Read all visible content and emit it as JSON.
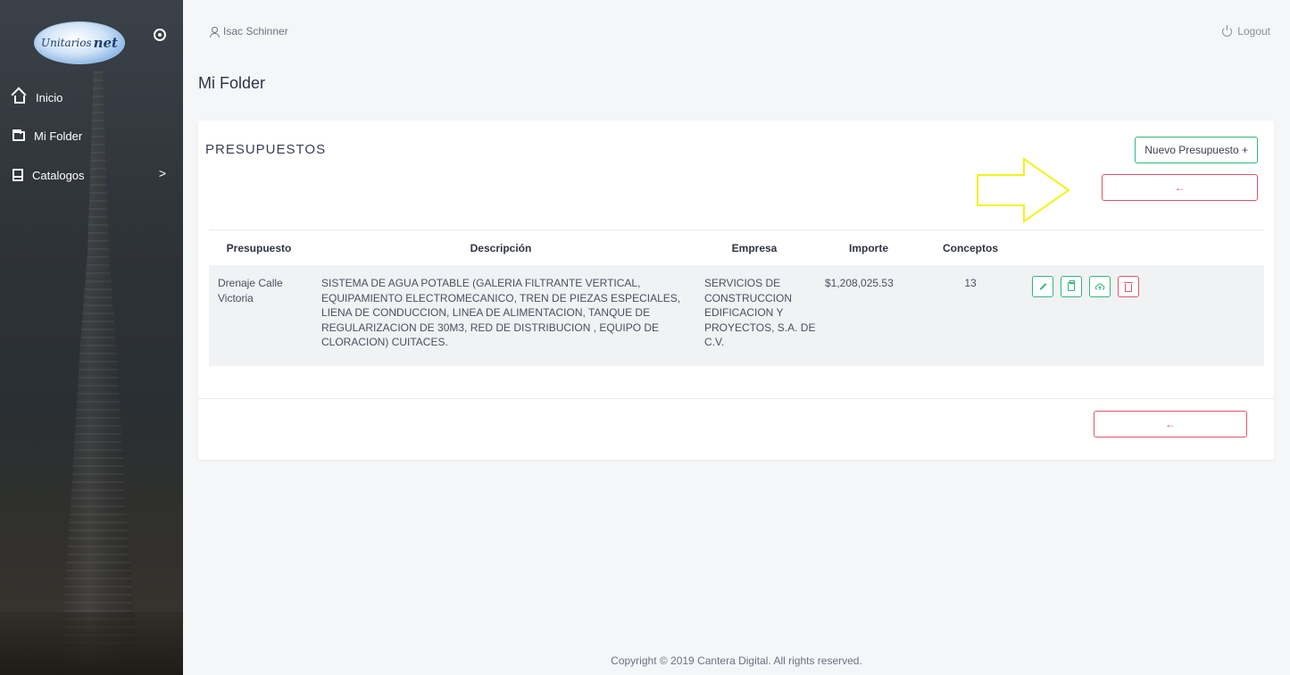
{
  "sidebar": {
    "logo_text": "Unitarios",
    "logo_suffix": "net",
    "items": [
      {
        "label": "Inicio",
        "icon": "home-icon"
      },
      {
        "label": "Mi Folder",
        "icon": "folder-icon"
      },
      {
        "label": "Catalogos",
        "icon": "book-icon",
        "chevron": ">"
      }
    ]
  },
  "header": {
    "user_name": "Isac Schinner",
    "logout_label": "Logout",
    "page_title": "Mi Folder"
  },
  "card": {
    "title": "PRESUPUESTOS",
    "new_button_label": "Nuevo Presupuesto +",
    "back_arrow": "←",
    "columns": [
      "Presupuesto",
      "Descripción",
      "Empresa",
      "Importe",
      "Conceptos"
    ],
    "rows": [
      {
        "presupuesto": "Drenaje Calle Victoria",
        "descripcion": "SISTEMA DE AGUA POTABLE (GALERIA FILTRANTE VERTICAL, EQUIPAMIENTO ELECTROMECANICO, TREN DE PIEZAS ESPECIALES, LIENA DE CONDUCCION, LINEA DE ALIMENTACION, TANQUE DE REGULARIZACION DE 30M3, RED DE DISTRIBUCION , EQUIPO DE CLORACION) CUITACES.",
        "empresa": "SERVICIOS DE CONSTRUCCION EDIFICACION Y PROYECTOS, S.A. DE C.V.",
        "importe": "$1,208,025.53",
        "conceptos": "13"
      }
    ]
  },
  "footer": {
    "copyright": "Copyright © 2019 Cantera Digital. All rights reserved."
  },
  "colors": {
    "accent_green": "#2fb87c",
    "accent_red": "#e0536a",
    "annotation_yellow": "#f2f21a"
  }
}
